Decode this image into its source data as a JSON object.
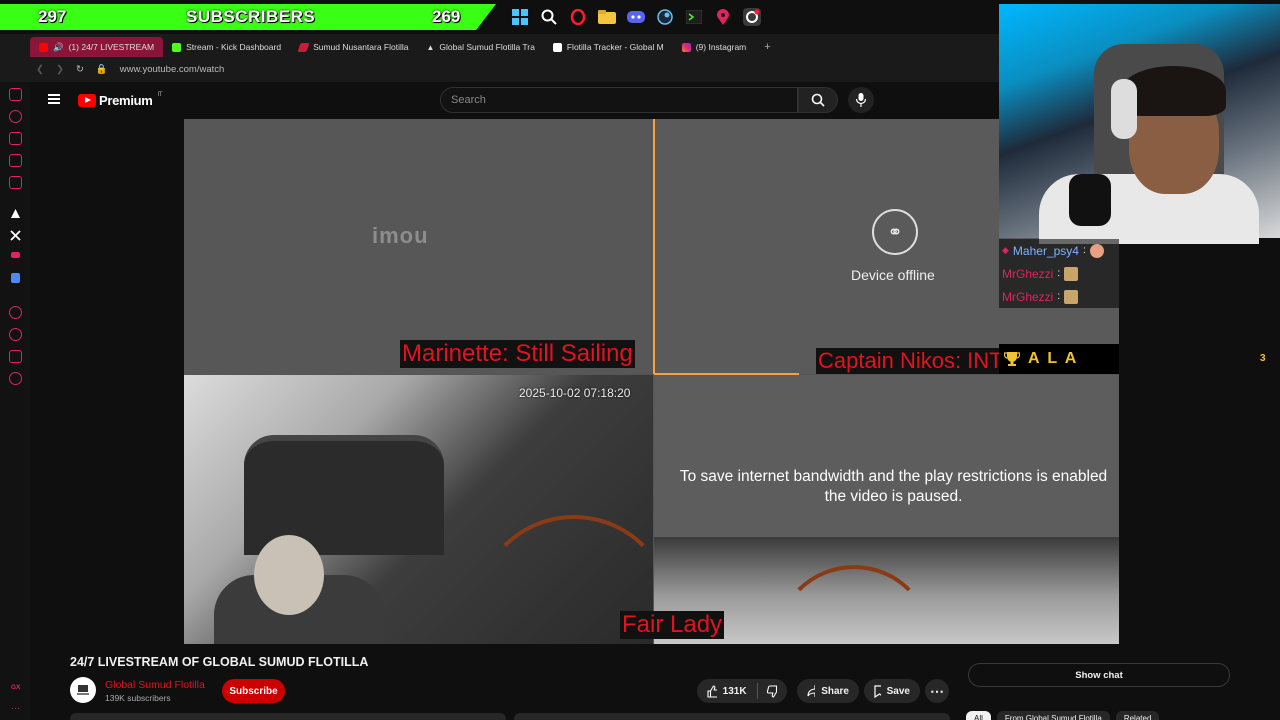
{
  "subscriber_banner": {
    "left_count": "297",
    "label": "SUBSCRIBERS",
    "right_count": "269"
  },
  "taskbar": [
    "windows-icon",
    "search-icon",
    "opera-icon",
    "folder-icon",
    "discord-icon",
    "steam-icon",
    "terminal-icon",
    "maps-icon",
    "opera-gx-icon"
  ],
  "browser": {
    "tabs": [
      {
        "label": "(1) 24/7 LIVESTREAM",
        "fav_color": "#ff0000",
        "active": true
      },
      {
        "label": "Stream - Kick Dashboard",
        "fav_color": "#53fc18"
      },
      {
        "label": "Sumud Nusantara Flotilla",
        "fav_color": "#c41e3a"
      },
      {
        "label": "Global Sumud Flotilla Tra",
        "fav_color": "#ffffff"
      },
      {
        "label": "Flotilla Tracker - Global M",
        "fav_color": "#ffffff"
      },
      {
        "label": "(9) Instagram",
        "fav_color": "#e1306c"
      }
    ],
    "new_tab": "+",
    "url": "www.youtube.com/watch"
  },
  "youtube": {
    "logo_text": "Premium",
    "logo_region": "IT",
    "search_placeholder": "Search"
  },
  "video": {
    "imou_text": "imou",
    "device_offline": "Device offline",
    "label_marinette": "Marinette: Still Sailing",
    "label_nikos": "Captain Nikos: INT",
    "label_fair_lady": "Fair Lady",
    "timestamp": "2025-10-02 07:18:20",
    "paused_line1": "To save internet bandwidth and the play restrictions is enabled",
    "paused_line2": "the video is paused."
  },
  "stream_overlay": {
    "chat": [
      {
        "user": "Maher_psy4",
        "color": "#7fb3ff"
      },
      {
        "user": "MrGhezzi",
        "color": "#e0245e"
      },
      {
        "user": "MrGhezzi",
        "color": "#e0245e"
      }
    ],
    "alert_text": "A L A",
    "alert_count": "3"
  },
  "below_video": {
    "title": "24/7 LIVESTREAM OF GLOBAL SUMUD FLOTILLA",
    "channel_name": "Global Sumud Flotilla",
    "channel_subs": "139K subscribers",
    "subscribe": "Subscribe",
    "likes": "131K",
    "share": "Share",
    "save": "Save",
    "show_chat": "Show chat",
    "chips": [
      "All",
      "From Global Sumud Flotilla",
      "Related"
    ]
  },
  "gx_label": "GX"
}
